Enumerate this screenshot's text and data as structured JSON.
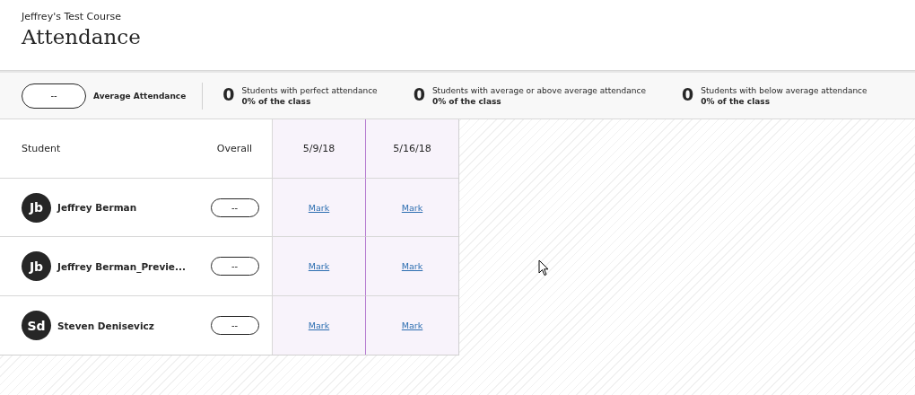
{
  "course": "Jeffrey's Test Course",
  "title": "Attendance",
  "summary": {
    "average": {
      "value": "--",
      "label": "Average Attendance"
    },
    "stats": [
      {
        "count": "0",
        "label": "Students with perfect attendance",
        "share": "0% of the class"
      },
      {
        "count": "0",
        "label": "Students with average or above average attendance",
        "share": "0% of the class"
      },
      {
        "count": "0",
        "label": "Students with below average attendance",
        "share": "0% of the class"
      }
    ]
  },
  "table": {
    "columns": [
      "Student",
      "Overall",
      "5/9/18",
      "5/16/18"
    ],
    "rows": [
      {
        "initials": "Jb",
        "name": "Jeffrey Berman",
        "overall": "--",
        "marks": [
          "Mark",
          "Mark"
        ]
      },
      {
        "initials": "Jb",
        "name": "Jeffrey Berman_Previe...",
        "overall": "--",
        "marks": [
          "Mark",
          "Mark"
        ]
      },
      {
        "initials": "Sd",
        "name": "Steven Denisevicz",
        "overall": "--",
        "marks": [
          "Mark",
          "Mark"
        ]
      }
    ]
  }
}
